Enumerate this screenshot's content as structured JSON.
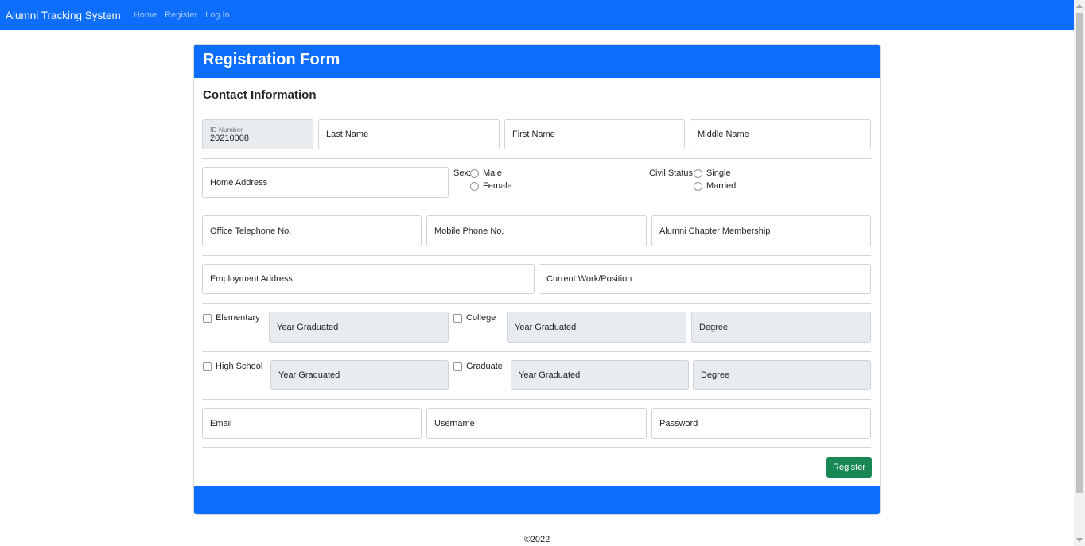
{
  "navbar": {
    "brand": "Alumni Tracking System",
    "links": [
      "Home",
      "Register",
      "Log In"
    ]
  },
  "form": {
    "title": "Registration Form",
    "section_title": "Contact Information",
    "id_number": {
      "label": "ID Number",
      "value": "20210008"
    },
    "last_name": {
      "placeholder": "Last Name"
    },
    "first_name": {
      "placeholder": "First Name"
    },
    "middle_name": {
      "placeholder": "Middle Name"
    },
    "home_address": {
      "placeholder": "Home Address"
    },
    "sex": {
      "label": "Sex:",
      "options": [
        "Male",
        "Female"
      ]
    },
    "civil_status": {
      "label": "Civil Status:",
      "options": [
        "Single",
        "Married"
      ]
    },
    "office_phone": {
      "placeholder": "Office Telephone No."
    },
    "mobile_phone": {
      "placeholder": "Mobile Phone No."
    },
    "alumni_chapter": {
      "placeholder": "Alumni Chapter Membership"
    },
    "employment_address": {
      "placeholder": "Employment Address"
    },
    "current_work": {
      "placeholder": "Current Work/Position"
    },
    "education": {
      "elementary": {
        "label": "Elementary",
        "year_placeholder": "Year Graduated"
      },
      "college": {
        "label": "College",
        "year_placeholder": "Year Graduated",
        "degree_placeholder": "Degree"
      },
      "high_school": {
        "label": "High School",
        "year_placeholder": "Year Graduated"
      },
      "graduate": {
        "label": "Graduate",
        "year_placeholder": "Year Graduated",
        "degree_placeholder": "Degree"
      }
    },
    "email": {
      "placeholder": "Email"
    },
    "username": {
      "placeholder": "Username"
    },
    "password": {
      "placeholder": "Password"
    },
    "submit_label": "Register"
  },
  "footer": {
    "copyright": "©2022"
  },
  "colors": {
    "primary": "#0d6efd",
    "success": "#198754",
    "disabled_bg": "#e9ecef"
  }
}
